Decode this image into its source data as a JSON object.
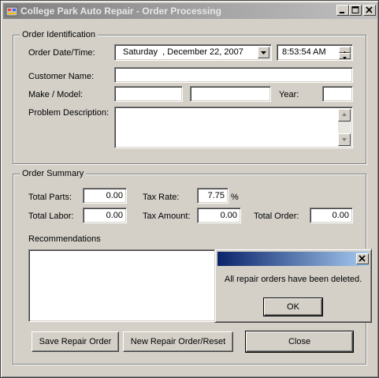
{
  "window": {
    "title": "College Park Auto Repair - Order Processing"
  },
  "order_identification": {
    "legend": "Order Identification",
    "date_time_label": "Order Date/Time:",
    "date_value": "Saturday  , December 22, 2007",
    "time_value": "8:53:54 AM",
    "customer_name_label": "Customer Name:",
    "customer_name_value": "",
    "make_model_label": "Make / Model:",
    "make_value": "",
    "model_value": "",
    "year_label": "Year:",
    "year_value": "",
    "problem_label": "Problem Description:",
    "problem_value": ""
  },
  "order_summary": {
    "legend": "Order Summary",
    "total_parts_label": "Total Parts:",
    "total_parts_value": "0.00",
    "total_labor_label": "Total Labor:",
    "total_labor_value": "0.00",
    "tax_rate_label": "Tax Rate:",
    "tax_rate_value": "7.75",
    "percent_symbol": "%",
    "tax_amount_label": "Tax Amount:",
    "tax_amount_value": "0.00",
    "total_order_label": "Total Order:",
    "total_order_value": "0.00",
    "recommendations_label": "Recommendations",
    "recommendations_value": ""
  },
  "buttons": {
    "save": "Save Repair Order",
    "new_reset": "New Repair Order/Reset",
    "close": "Close"
  },
  "message_box": {
    "title": "",
    "message": "All repair orders have been deleted.",
    "ok": "OK"
  },
  "icons": {
    "app": "app-icon",
    "minimize": "minimize-icon",
    "maximize": "maximize-icon",
    "close": "close-icon",
    "dropdown": "chevron-down-icon",
    "spin_up": "arrow-up-icon",
    "spin_down": "arrow-down-icon"
  }
}
